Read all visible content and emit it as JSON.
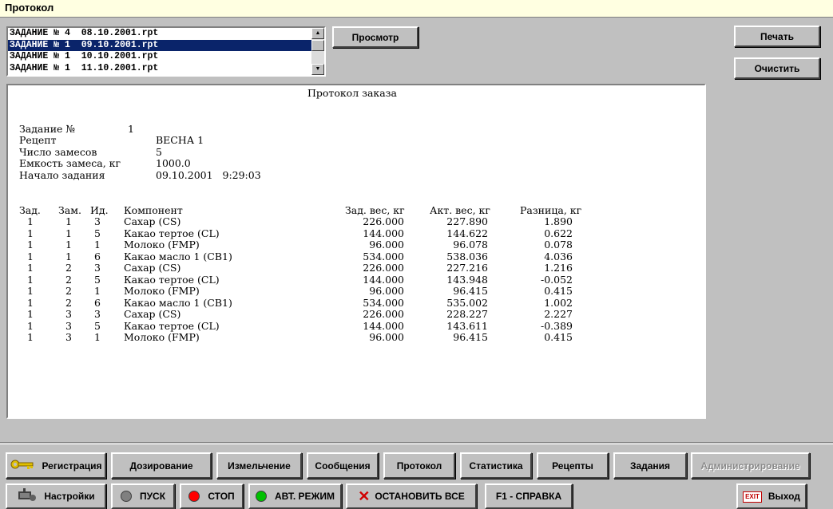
{
  "window": {
    "title": "Протокол"
  },
  "file_list": {
    "items": [
      "ЗАДАНИЕ № 4  08.10.2001.rpt",
      "ЗАДАНИЕ № 1  09.10.2001.rpt",
      "ЗАДАНИЕ № 1  10.10.2001.rpt",
      "ЗАДАНИЕ № 1  11.10.2001.rpt"
    ],
    "selected_index": 1
  },
  "buttons": {
    "view": "Просмотр",
    "print": "Печать",
    "clear": "Очистить"
  },
  "report": {
    "title": "Протокол заказа",
    "fields": [
      {
        "label": "Задание №",
        "value": "1"
      },
      {
        "label": "Рецепт",
        "value": "ВЕСНА 1"
      },
      {
        "label": "Число замесов",
        "value": "5"
      },
      {
        "label": "Емкость замеса, кг",
        "value": "1000.0"
      },
      {
        "label": "Начало задания",
        "value": "09.10.2001   9:29:03"
      }
    ],
    "columns": [
      "Зад.",
      "Зам.",
      "Ид.",
      "Компонент",
      "Зад. вес, кг",
      "Акт. вес, кг",
      "Разница, кг"
    ],
    "rows": [
      [
        "1",
        "1",
        "3",
        "Сахар (CS)",
        "226.000",
        "227.890",
        "1.890"
      ],
      [
        "1",
        "1",
        "5",
        "Какао тертое (CL)",
        "144.000",
        "144.622",
        "0.622"
      ],
      [
        "1",
        "1",
        "1",
        "Молоко (FMP)",
        "96.000",
        "96.078",
        "0.078"
      ],
      [
        "1",
        "1",
        "6",
        "Какао масло 1 (CB1)",
        "534.000",
        "538.036",
        "4.036"
      ],
      [
        "1",
        "2",
        "3",
        "Сахар (CS)",
        "226.000",
        "227.216",
        "1.216"
      ],
      [
        "1",
        "2",
        "5",
        "Какао тертое (CL)",
        "144.000",
        "143.948",
        "-0.052"
      ],
      [
        "1",
        "2",
        "1",
        "Молоко (FMP)",
        "96.000",
        "96.415",
        "0.415"
      ],
      [
        "1",
        "2",
        "6",
        "Какао масло 1 (CB1)",
        "534.000",
        "535.002",
        "1.002"
      ],
      [
        "1",
        "3",
        "3",
        "Сахар (CS)",
        "226.000",
        "228.227",
        "2.227"
      ],
      [
        "1",
        "3",
        "5",
        "Какао тертое (CL)",
        "144.000",
        "143.611",
        "-0.389"
      ],
      [
        "1",
        "3",
        "1",
        "Молоко (FMP)",
        "96.000",
        "96.415",
        "0.415"
      ]
    ]
  },
  "nav": {
    "registration": "Регистрация",
    "dosing": "Дозирование",
    "grinding": "Измельчение",
    "messages": "Сообщения",
    "protocol": "Протокол",
    "statistics": "Статистика",
    "recipes": "Рецепты",
    "tasks": "Задания",
    "administration": "Администрирование"
  },
  "controls": {
    "settings": "Настройки",
    "start": "ПУСК",
    "stop": "СТОП",
    "auto_mode": "АВТ. РЕЖИМ",
    "stop_all": "ОСТАНОВИТЬ ВСЕ",
    "help": "F1 - СПРАВКА",
    "exit": "Выход",
    "exit_icon_text": "EXIT"
  },
  "colors": {
    "start_indicator": "#808080",
    "stop_indicator": "#ff0000",
    "auto_indicator": "#00c000",
    "stop_all_icon": "#d00000"
  }
}
